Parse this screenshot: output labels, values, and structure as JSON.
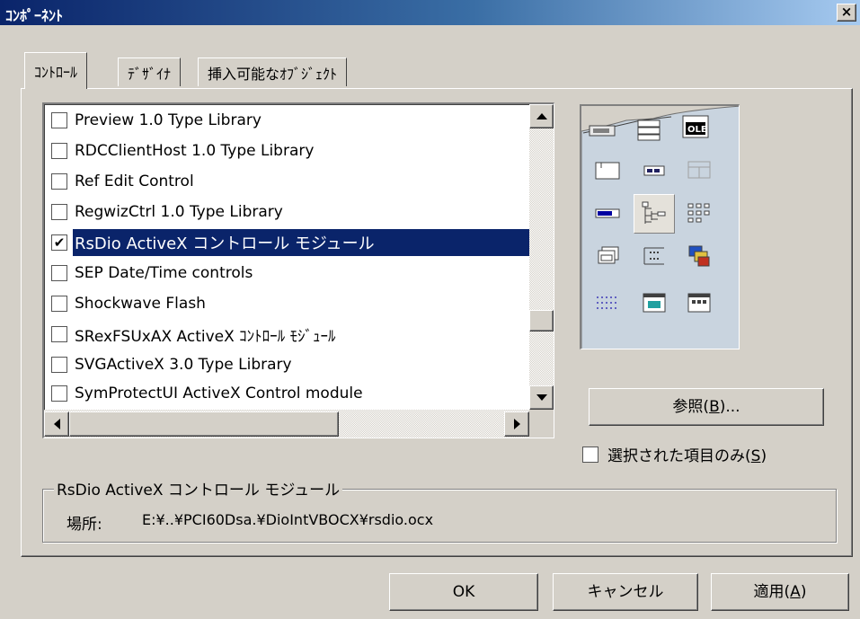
{
  "window": {
    "title": "ｺﾝﾎﾟｰﾈﾝﾄ",
    "close_glyph": "×"
  },
  "tabs": [
    {
      "label": "ｺﾝﾄﾛｰﾙ",
      "active": true
    },
    {
      "label": "ﾃﾞｻﾞｲﾅ",
      "active": false
    },
    {
      "label": "挿入可能なｵﾌﾞｼﾞｪｸﾄ",
      "active": false
    }
  ],
  "components": [
    {
      "label": "Preview 1.0 Type Library",
      "checked": false
    },
    {
      "label": "RDCClientHost 1.0 Type Library",
      "checked": false
    },
    {
      "label": "Ref Edit Control",
      "checked": false
    },
    {
      "label": "RegwizCtrl 1.0 Type Library",
      "checked": false
    },
    {
      "label": "RsDio ActiveX コントロール モジュール",
      "checked": true,
      "selected": true
    },
    {
      "label": "SEP Date/Time controls",
      "checked": false
    },
    {
      "label": "Shockwave Flash",
      "checked": false
    },
    {
      "label": "SRexFSUxAX ActiveX ｺﾝﾄﾛｰﾙ ﾓｼﾞｭｰﾙ",
      "checked": false
    },
    {
      "label": "SVGActiveX 3.0 Type Library",
      "checked": false
    },
    {
      "label": "SymProtectUI ActiveX Control module",
      "checked": false
    }
  ],
  "checkmark": "✔",
  "toolbox_icons": [
    "ole-icon",
    "label-icon",
    "textbox-icon",
    "frame-icon",
    "progressbar-icon",
    "treeview-icon",
    "listview-icon",
    "tabstrip-icon",
    "toolbar-icon",
    "imagelist-icon",
    "statusbar-icon",
    "form-icon",
    "grid-icon"
  ],
  "browse_button": {
    "label_prefix": "参照(",
    "accesskey": "B",
    "label_suffix": ")..."
  },
  "only_selected": {
    "label_prefix": "選択された項目のみ(",
    "accesskey": "S",
    "label_suffix": ")",
    "checked": false
  },
  "details": {
    "name": "RsDio ActiveX コントロール モジュール",
    "location_label": "場所:",
    "location_value": "E:¥..¥PCI60Dsa.¥DioIntVBOCX¥rsdio.ocx"
  },
  "footer": {
    "ok": "OK",
    "cancel": "キャンセル",
    "apply_prefix": "適用(",
    "apply_accesskey": "A",
    "apply_suffix": ")"
  },
  "colors": {
    "face": "#d4d0c8",
    "selection": "#0a246a",
    "titlebar_start": "#0a246a",
    "titlebar_end": "#a6caf0"
  }
}
